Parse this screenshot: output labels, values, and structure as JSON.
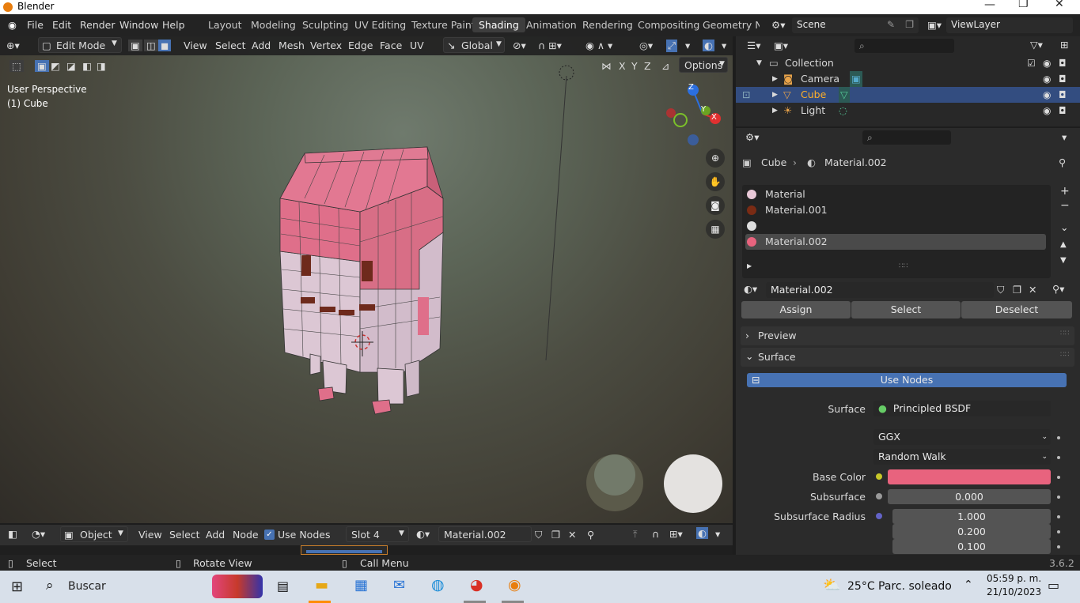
{
  "window": {
    "title": "Blender"
  },
  "menus": [
    "File",
    "Edit",
    "Render",
    "Window",
    "Help"
  ],
  "workspaces": [
    "Layout",
    "Modeling",
    "Sculpting",
    "UV Editing",
    "Texture Paint",
    "Shading",
    "Animation",
    "Rendering",
    "Compositing",
    "Geometry Noc"
  ],
  "active_workspace": "Shading",
  "scene": {
    "name": "Scene",
    "view_layer": "ViewLayer"
  },
  "viewport": {
    "mode": "Edit Mode",
    "menus": [
      "View",
      "Select",
      "Add",
      "Mesh",
      "Vertex",
      "Edge",
      "Face",
      "UV"
    ],
    "transform_orientation": "Global",
    "options_label": "Options",
    "axes": [
      "X",
      "Y",
      "Z"
    ],
    "overlay_text": [
      "User Perspective",
      "(1) Cube"
    ],
    "gizmo": {
      "x": "X",
      "y": "Y",
      "z": "Z"
    }
  },
  "outliner": {
    "collection": "Collection",
    "items": [
      {
        "name": "Camera",
        "color": "#e8a34a"
      },
      {
        "name": "Cube",
        "color": "#e8a34a",
        "selected": true
      },
      {
        "name": "Light",
        "color": "#e8a34a"
      }
    ]
  },
  "properties": {
    "breadcrumb": {
      "object": "Cube",
      "material": "Material.002"
    },
    "slots": [
      {
        "name": "Material",
        "color": "#e9c9d8"
      },
      {
        "name": "Material.001",
        "color": "#7a2b14"
      },
      {
        "name": "",
        "color": "#dddddd"
      },
      {
        "name": "Material.002",
        "color": "#e8637e",
        "selected": true
      }
    ],
    "material_name": "Material.002",
    "buttons": {
      "assign": "Assign",
      "select": "Select",
      "deselect": "Deselect"
    },
    "panels": {
      "preview": "Preview",
      "surface": "Surface"
    },
    "use_nodes": "Use Nodes",
    "surface": {
      "label": "Surface",
      "value": "Principled BSDF"
    },
    "distribution": "GGX",
    "subsurface_method": "Random Walk",
    "base_color": {
      "label": "Base Color",
      "color": "#e8637e"
    },
    "subsurface": {
      "label": "Subsurface",
      "value": "0.000"
    },
    "subsurface_radius": {
      "label": "Subsurface Radius",
      "values": [
        "1.000",
        "0.200",
        "0.100"
      ]
    }
  },
  "node_editor": {
    "mode": "Object",
    "menus": [
      "View",
      "Select",
      "Add",
      "Node"
    ],
    "use_nodes": "Use Nodes",
    "slot": "Slot 4",
    "material": "Material.002"
  },
  "statusbar": {
    "select": "Select",
    "rotate": "Rotate View",
    "call_menu": "Call Menu",
    "version": "3.6.2"
  },
  "taskbar": {
    "search": "Buscar",
    "weather": "25°C  Parc. soleado",
    "time": "05:59 p. m.",
    "date": "21/10/2023"
  }
}
